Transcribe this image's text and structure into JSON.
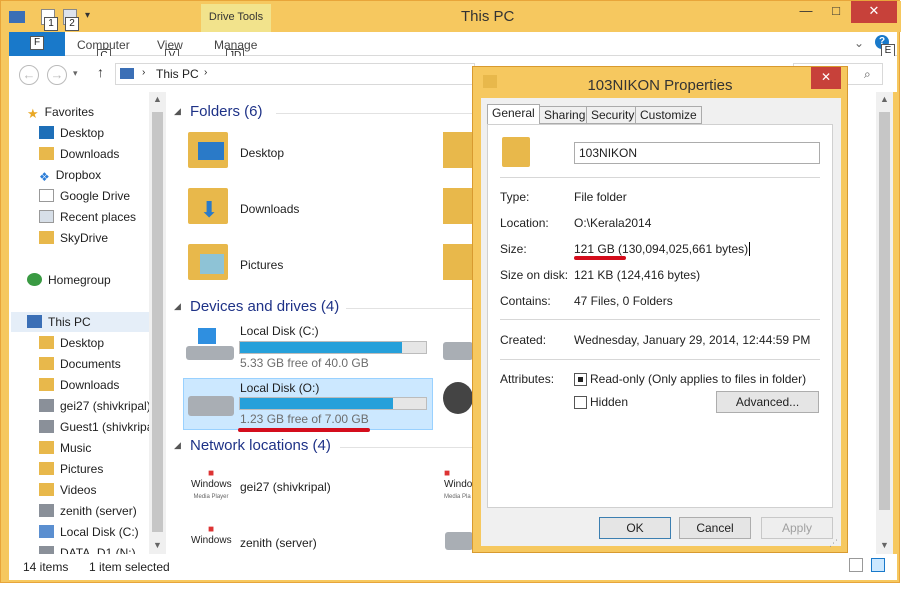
{
  "window": {
    "title": "This PC",
    "contextual_tab": "Drive Tools",
    "minimize": "—",
    "maximize": "□",
    "close": "✕"
  },
  "qat": {
    "keytip_1": "1",
    "keytip_2": "2"
  },
  "ribbon": {
    "file_keytip": "F",
    "tabs": [
      {
        "label": "Computer",
        "keytip": "C"
      },
      {
        "label": "View",
        "keytip": "V"
      },
      {
        "label": "Manage",
        "keytip": "JD"
      }
    ],
    "help_keytip": "E"
  },
  "address": {
    "crumb": "This PC",
    "back": "←",
    "forward": "→",
    "up": "↑"
  },
  "nav": {
    "favorites": {
      "label": "Favorites",
      "items": [
        "Desktop",
        "Downloads",
        "Dropbox",
        "Google Drive",
        "Recent places",
        "SkyDrive"
      ]
    },
    "homegroup": "Homegroup",
    "thispc": {
      "label": "This PC",
      "items": [
        "Desktop",
        "Documents",
        "Downloads",
        "gei27 (shivkripal)",
        "Guest1 (shivkripa",
        "Music",
        "Pictures",
        "Videos",
        "zenith (server)",
        "Local Disk (C:)",
        "DATA_D1 (N:)"
      ]
    }
  },
  "content": {
    "folders_header": "Folders (6)",
    "folders": [
      "Desktop",
      "Downloads",
      "Pictures"
    ],
    "devices_header": "Devices and drives (4)",
    "drives": [
      {
        "name": "Local Disk (C:)",
        "free": "5.33 GB free of 40.0 GB",
        "used_fraction": 0.87
      },
      {
        "name": "Local Disk (O:)",
        "free": "1.23 GB free of 7.00 GB",
        "used_fraction": 0.82
      }
    ],
    "network_header": "Network locations (4)",
    "network": [
      {
        "name": "gei27 (shivkripal)",
        "logo": "Windows",
        "sublogo": "Media Player"
      },
      {
        "name": "zenith (server)",
        "logo": "Windows",
        "sublogo": ""
      }
    ],
    "partial_logo": "Windo",
    "partial_sublogo": "Media Pla"
  },
  "status": {
    "items": "14 items",
    "selected": "1 item selected"
  },
  "dialog": {
    "title": "103NIKON Properties",
    "close": "✕",
    "tabs": [
      "General",
      "Sharing",
      "Security",
      "Customize"
    ],
    "name": "103NIKON",
    "type_label": "Type:",
    "type": "File folder",
    "location_label": "Location:",
    "location": "O:\\Kerala2014",
    "size_label": "Size:",
    "size": "121 GB (130,094,025,661 bytes)",
    "size_on_disk_label": "Size on disk:",
    "size_on_disk": "121 KB (124,416 bytes)",
    "contains_label": "Contains:",
    "contains": "47 Files, 0 Folders",
    "created_label": "Created:",
    "created": "Wednesday, January 29, 2014, 12:44:59 PM",
    "attributes_label": "Attributes:",
    "readonly": "Read-only (Only applies to files in folder)",
    "hidden": "Hidden",
    "advanced": "Advanced...",
    "ok": "OK",
    "cancel": "Cancel",
    "apply": "Apply"
  },
  "colors": {
    "accent": "#1979ca",
    "title_bar": "#f6c85f",
    "drive_fill": "#26a0da",
    "annotation": "#d40d1c"
  }
}
